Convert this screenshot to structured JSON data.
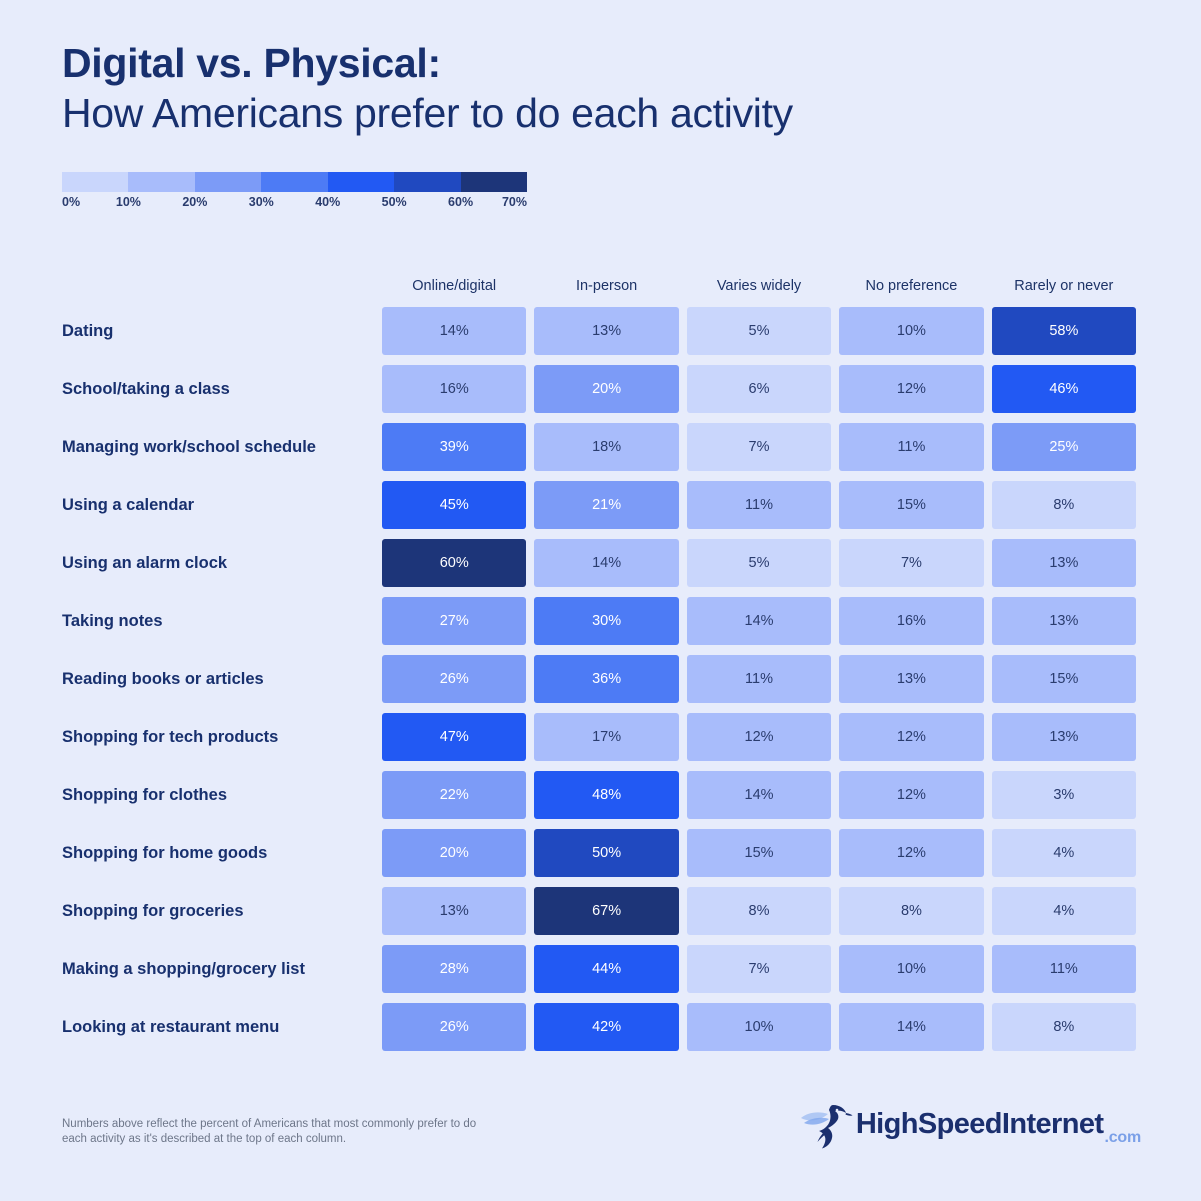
{
  "title": {
    "line1": "Digital vs. Physical:",
    "line2": "How Americans prefer to do each activity"
  },
  "legend": {
    "ticks": [
      "0%",
      "10%",
      "20%",
      "30%",
      "40%",
      "50%",
      "60%",
      "70%"
    ],
    "bands": [
      {
        "range": "0-10%",
        "color": "#c9d6fc"
      },
      {
        "range": "10-20%",
        "color": "#a8bcfb"
      },
      {
        "range": "20-30%",
        "color": "#7c9bf7"
      },
      {
        "range": "30-40%",
        "color": "#4d7bf5"
      },
      {
        "range": "40-50%",
        "color": "#2259f3"
      },
      {
        "range": "50-60%",
        "color": "#2049c0"
      },
      {
        "range": "60-70%",
        "color": "#1d3579"
      }
    ]
  },
  "footer": {
    "note": "Numbers above reflect the percent of Americans that most commonly prefer to do each activity as it's described at the top of each column.",
    "logo_wordmark": "HighSpeedInternet",
    "logo_tld": ".com"
  },
  "chart_data": {
    "type": "heatmap",
    "title": "Digital vs. Physical: How Americans prefer to do each activity",
    "xlabel": "",
    "ylabel": "",
    "unit": "percent",
    "value_range": [
      3,
      67
    ],
    "colorbar": {
      "ticks": [
        0,
        10,
        20,
        30,
        40,
        50,
        60,
        70
      ],
      "tick_labels": [
        "0%",
        "10%",
        "20%",
        "30%",
        "40%",
        "50%",
        "60%",
        "70%"
      ],
      "position": "top-left"
    },
    "categories": [
      "Online/digital",
      "In-person",
      "Varies widely",
      "No preference",
      "Rarely or never"
    ],
    "rows": [
      {
        "label": "Dating",
        "values": [
          14,
          13,
          5,
          10,
          58
        ],
        "display": [
          "14%",
          "13%",
          "5%",
          "10%",
          "58%"
        ]
      },
      {
        "label": "School/taking a class",
        "values": [
          16,
          20,
          6,
          12,
          46
        ],
        "display": [
          "16%",
          "20%",
          "6%",
          "12%",
          "46%"
        ]
      },
      {
        "label": "Managing work/school schedule",
        "values": [
          39,
          18,
          7,
          11,
          25
        ],
        "display": [
          "39%",
          "18%",
          "7%",
          "11%",
          "25%"
        ]
      },
      {
        "label": "Using a calendar",
        "values": [
          45,
          21,
          11,
          15,
          8
        ],
        "display": [
          "45%",
          "21%",
          "11%",
          "15%",
          "8%"
        ]
      },
      {
        "label": "Using an alarm clock",
        "values": [
          60,
          14,
          5,
          7,
          13
        ],
        "display": [
          "60%",
          "14%",
          "5%",
          "7%",
          "13%"
        ]
      },
      {
        "label": "Taking notes",
        "values": [
          27,
          30,
          14,
          16,
          13
        ],
        "display": [
          "27%",
          "30%",
          "14%",
          "16%",
          "13%"
        ]
      },
      {
        "label": "Reading books or articles",
        "values": [
          26,
          36,
          11,
          13,
          15
        ],
        "display": [
          "26%",
          "36%",
          "11%",
          "13%",
          "15%"
        ]
      },
      {
        "label": "Shopping for tech products",
        "values": [
          47,
          17,
          12,
          12,
          13
        ],
        "display": [
          "47%",
          "17%",
          "12%",
          "12%",
          "13%"
        ]
      },
      {
        "label": "Shopping for clothes",
        "values": [
          22,
          48,
          14,
          12,
          3
        ],
        "display": [
          "22%",
          "48%",
          "14%",
          "12%",
          "3%"
        ]
      },
      {
        "label": "Shopping for home goods",
        "values": [
          20,
          50,
          15,
          12,
          4
        ],
        "display": [
          "20%",
          "50%",
          "15%",
          "12%",
          "4%"
        ]
      },
      {
        "label": "Shopping for groceries",
        "values": [
          13,
          67,
          8,
          8,
          4
        ],
        "display": [
          "13%",
          "67%",
          "8%",
          "8%",
          "4%"
        ]
      },
      {
        "label": "Making a shopping/grocery list",
        "values": [
          28,
          44,
          7,
          10,
          11
        ],
        "display": [
          "28%",
          "44%",
          "7%",
          "10%",
          "11%"
        ]
      },
      {
        "label": "Looking at restaurant menu",
        "values": [
          26,
          42,
          10,
          14,
          8
        ],
        "display": [
          "26%",
          "42%",
          "10%",
          "14%",
          "8%"
        ]
      }
    ]
  }
}
